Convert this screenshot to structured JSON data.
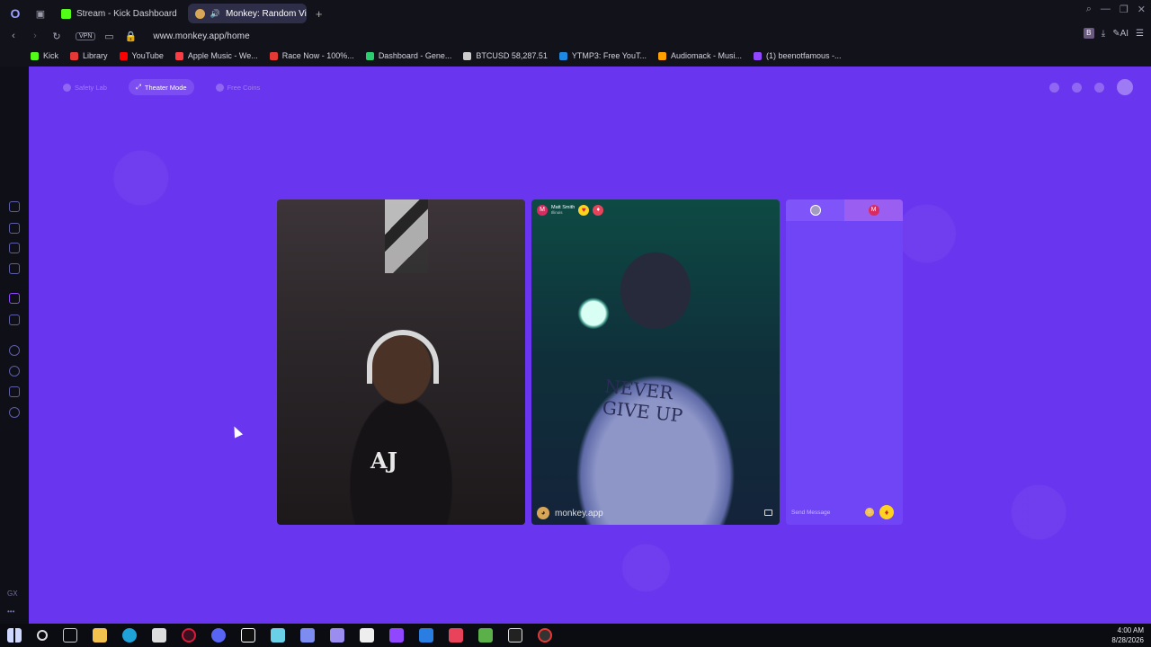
{
  "browser": {
    "tabs": [
      {
        "label": "Stream - Kick Dashboard",
        "color": "#53fc18"
      },
      {
        "label": "Monkey: Random Video Chat",
        "color": "#d8a657"
      }
    ],
    "url": "www.monkey.app/home",
    "vpn_label": "VPN",
    "ai_label": "AI",
    "profile_label": "B",
    "bookmarks": [
      {
        "label": "Kick",
        "color": "#53fc18"
      },
      {
        "label": "Library",
        "color": "#e53935"
      },
      {
        "label": "YouTube",
        "color": "#ff0000"
      },
      {
        "label": "Apple Music - We...",
        "color": "#fc3c44"
      },
      {
        "label": "Race Now - 100%...",
        "color": "#e53935"
      },
      {
        "label": "Dashboard - Gene...",
        "color": "#2ecc71"
      },
      {
        "label": "BTCUSD 58,287.51",
        "color": "#cccccc"
      },
      {
        "label": "YTMP3: Free YouT...",
        "color": "#1e88e5"
      },
      {
        "label": "Audiomack - Musi...",
        "color": "#ffa200"
      },
      {
        "label": "(1) beenotfamous -...",
        "color": "#9146ff"
      }
    ]
  },
  "page": {
    "nav": [
      {
        "label": "Safety Lab",
        "active": false
      },
      {
        "label": "Theater Mode",
        "active": true
      },
      {
        "label": "Free Coins",
        "active": false
      }
    ],
    "peer": {
      "initial": "M",
      "name": "Matt Smith",
      "subtitle": "Illinois"
    },
    "watermark": "monkey.app",
    "chat": {
      "placeholder": "Send Message",
      "tab2_initial": "M"
    }
  },
  "sidebar": {
    "bottom_label": "GX"
  },
  "taskbar": {
    "time": "4:00 AM",
    "date": "8/28/2026"
  }
}
